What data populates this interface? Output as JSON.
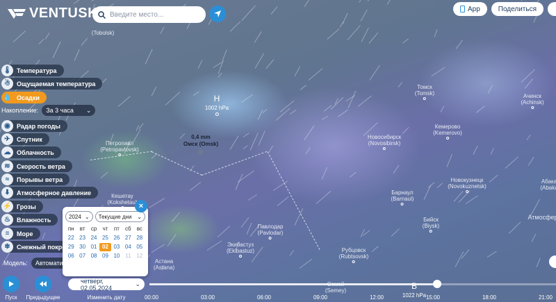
{
  "app": {
    "logo_text": "VENTUSKY",
    "search_placeholder": "Введите место...",
    "app_button": "App",
    "share_button": "Поделиться"
  },
  "layers": [
    {
      "label": "Температура",
      "icon": "thermometer-icon",
      "active": false
    },
    {
      "label": "Ощущаемая температура",
      "icon": "person-temp-icon",
      "active": false
    },
    {
      "label": "Осадки",
      "icon": "raindrop-icon",
      "active": true
    },
    {
      "label": "Радар погоды",
      "icon": "radar-icon",
      "active": false
    },
    {
      "label": "Спутник",
      "icon": "satellite-icon",
      "active": false
    },
    {
      "label": "Облачность",
      "icon": "cloud-icon",
      "active": false
    },
    {
      "label": "Скорость ветра",
      "icon": "wind-icon",
      "active": false
    },
    {
      "label": "Порывы ветра",
      "icon": "gust-icon",
      "active": false
    },
    {
      "label": "Атмосферное давление",
      "icon": "pressure-icon",
      "active": false
    },
    {
      "label": "Грозы",
      "icon": "lightning-icon",
      "active": false
    },
    {
      "label": "Влажность",
      "icon": "humidity-icon",
      "active": false
    },
    {
      "label": "Море",
      "icon": "waves-icon",
      "active": false
    },
    {
      "label": "Снежный покров",
      "icon": "snowflake-icon",
      "active": false
    }
  ],
  "accumulation": {
    "label": "Накопление:",
    "value": "За 3 часа"
  },
  "model": {
    "label": "Модель:",
    "value": "Автоматич"
  },
  "map": {
    "highlight": {
      "value": "0,4 mm",
      "city": "Омск (Omsk)"
    },
    "pressure_systems": [
      {
        "letter": "Н",
        "value": "1002 hPa"
      },
      {
        "letter": "В",
        "value": "1022 hPa"
      }
    ],
    "cities": [
      {
        "name": "Томск",
        "en": "(Tomsk)"
      },
      {
        "name": "Кемерово",
        "en": "(Kemerovo)"
      },
      {
        "name": "Ачинск",
        "en": "(Achinsk)"
      },
      {
        "name": "Новосибирск",
        "en": "(Novosibirsk)"
      },
      {
        "name": "Петропавл",
        "en": "(Petropavlovsk)"
      },
      {
        "name": "Кешетау",
        "en": "(Kokshetau)"
      },
      {
        "name": "Барнаул",
        "en": "(Barnaul)"
      },
      {
        "name": "Новокузнецк",
        "en": "(Novokuznetsk)"
      },
      {
        "name": "Абака",
        "en": "(Abaka"
      },
      {
        "name": "Бийск",
        "en": "(Biysk)"
      },
      {
        "name": "Павлодар",
        "en": "(Pavlodar)"
      },
      {
        "name": "Экибастуз",
        "en": "(Ekibastuz)"
      },
      {
        "name": "Рубцовск",
        "en": "(Rubtsovsk)"
      },
      {
        "name": "Астана",
        "en": "(Astana)"
      },
      {
        "name": "Семей",
        "en": "(Semey)"
      },
      {
        "name": "",
        "en": "(Tobolsk)"
      },
      {
        "name": "Атмосфер",
        "en": ""
      }
    ]
  },
  "calendar": {
    "year": "2024",
    "range": "Текущие дни",
    "weekdays": [
      "пн",
      "вт",
      "ср",
      "чт",
      "пт",
      "сб",
      "вс"
    ],
    "rows": [
      [
        "22",
        "23",
        "24",
        "25",
        "26",
        "27",
        "28"
      ],
      [
        "29",
        "30",
        "01",
        "02",
        "03",
        "04",
        "05"
      ],
      [
        "06",
        "07",
        "08",
        "09",
        "10",
        "11",
        "12"
      ]
    ],
    "selected": "02"
  },
  "timeline": {
    "play_label": "Пуск",
    "prev_label": "Предыдущее",
    "date_label": "Изменить дату",
    "date_value": "четверг, 02.05.2024",
    "hours": [
      "00:00",
      "03:00",
      "06:00",
      "09:00",
      "12:00",
      "15:00",
      "18:00",
      "21:00"
    ],
    "position_fraction": 0.69
  },
  "colors": {
    "accent": "#2a8fd6",
    "active_layer": "#f29a1f"
  }
}
